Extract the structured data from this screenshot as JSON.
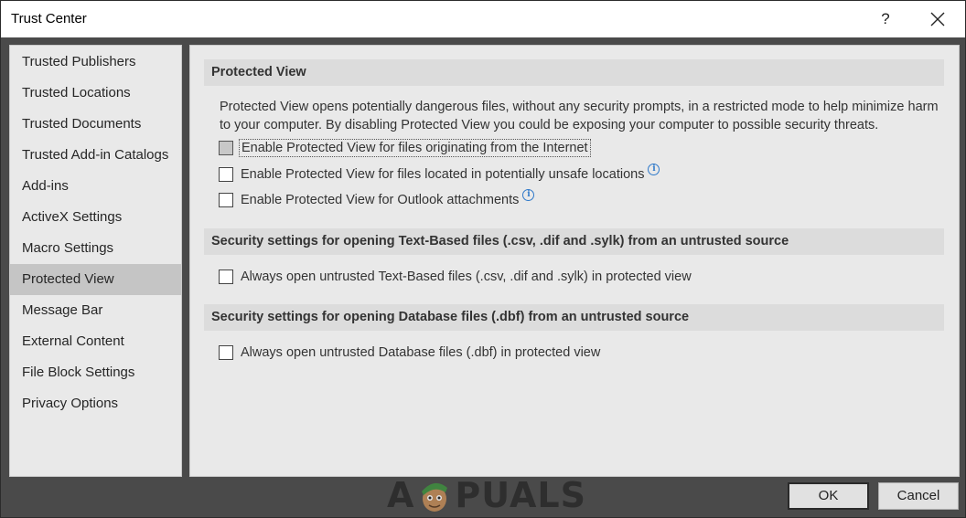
{
  "window": {
    "title": "Trust Center",
    "help_label": "?"
  },
  "sidebar": {
    "items": [
      {
        "label": "Trusted Publishers"
      },
      {
        "label": "Trusted Locations"
      },
      {
        "label": "Trusted Documents"
      },
      {
        "label": "Trusted Add-in Catalogs"
      },
      {
        "label": "Add-ins"
      },
      {
        "label": "ActiveX Settings"
      },
      {
        "label": "Macro Settings"
      },
      {
        "label": "Protected View",
        "selected": true
      },
      {
        "label": "Message Bar"
      },
      {
        "label": "External Content"
      },
      {
        "label": "File Block Settings"
      },
      {
        "label": "Privacy Options"
      }
    ]
  },
  "main": {
    "protected_view": {
      "header": "Protected View",
      "description": "Protected View opens potentially dangerous files, without any security prompts, in a restricted mode to help minimize harm to your computer. By disabling Protected View you could be exposing your computer to possible security threats.",
      "options": [
        {
          "label": "Enable Protected View for files originating from the Internet",
          "checked": false,
          "focused": true
        },
        {
          "label": "Enable Protected View for files located in potentially unsafe locations",
          "checked": false,
          "info": true
        },
        {
          "label": "Enable Protected View for Outlook attachments",
          "checked": false,
          "info": true
        }
      ]
    },
    "text_based": {
      "header": "Security settings for opening Text-Based files (.csv, .dif and .sylk) from an untrusted source",
      "option": {
        "label": "Always open untrusted Text-Based files (.csv, .dif and .sylk) in protected view",
        "checked": false
      }
    },
    "database": {
      "header": "Security settings for opening Database files (.dbf) from an untrusted source",
      "option": {
        "label": "Always open untrusted Database files (.dbf) in protected view",
        "checked": false
      }
    }
  },
  "watermark": {
    "left": "A",
    "right": "PUALS"
  },
  "buttons": {
    "ok": "OK",
    "cancel": "Cancel"
  },
  "icons": {
    "info": "info-icon",
    "close": "close-icon"
  }
}
